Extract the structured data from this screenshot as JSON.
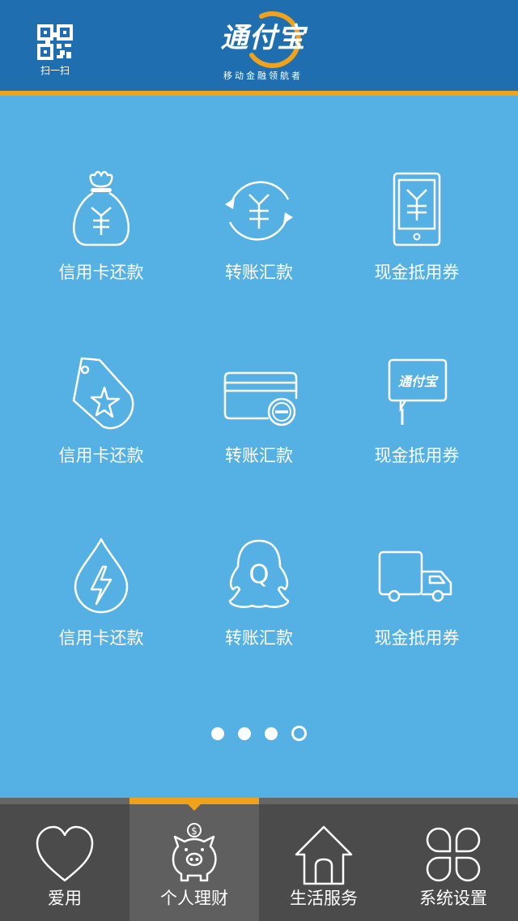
{
  "header": {
    "scan_label": "扫一扫",
    "brand": "通付宝",
    "slogan": "移动金融领航者"
  },
  "colors": {
    "header_bg": "#1f6fb0",
    "accent": "#f0a21b",
    "grid_bg": "#55b0e4",
    "nav_bg": "#4b4b4b",
    "nav_active_bg": "#5f5f5f"
  },
  "grid": {
    "tiles": [
      {
        "label": "信用卡还款",
        "icon": "money-bag-icon"
      },
      {
        "label": "转账汇款",
        "icon": "yuan-refresh-icon"
      },
      {
        "label": "现金抵用券",
        "icon": "phone-yuan-icon"
      },
      {
        "label": "信用卡还款",
        "icon": "star-tag-icon"
      },
      {
        "label": "转账汇款",
        "icon": "card-minus-icon"
      },
      {
        "label": "现金抵用券",
        "icon": "tongfubao-sign-icon"
      },
      {
        "label": "信用卡还款",
        "icon": "water-lightning-icon"
      },
      {
        "label": "转账汇款",
        "icon": "qq-penguin-icon"
      },
      {
        "label": "现金抵用券",
        "icon": "truck-icon"
      }
    ]
  },
  "pager": {
    "count": 4,
    "active_index": 3
  },
  "nav": {
    "items": [
      {
        "label": "爱用",
        "icon": "heart-icon"
      },
      {
        "label": "个人理财",
        "icon": "piggy-bank-icon"
      },
      {
        "label": "生活服务",
        "icon": "house-icon"
      },
      {
        "label": "系统设置",
        "icon": "clover-grid-icon"
      }
    ],
    "active_index": 1
  }
}
